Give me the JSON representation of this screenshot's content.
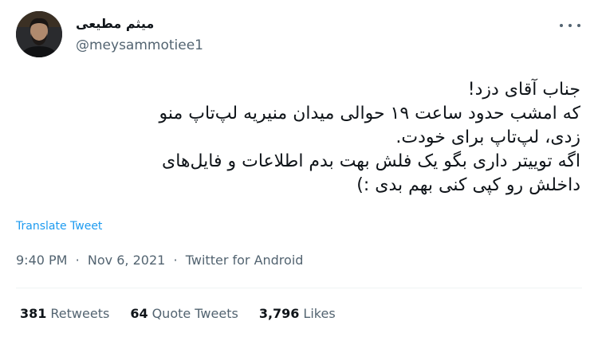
{
  "author": {
    "display_name": "میثم مطیعی",
    "handle": "@meysammotiee1"
  },
  "tweet": {
    "lines": [
      "جناب آقای دزد!",
      "که امشب حدود ساعت ۱۹ حوالی میدان منیریه لپ‌تاپ منو",
      "زدی، لپ‌تاپ برای خودت.",
      "اگه توییتر داری بگو یک فلش بهت بدم اطلاعات و فایل‌های",
      "داخلش رو کپی کنی بهم بدی :)"
    ],
    "translate_label": "Translate Tweet",
    "time": "9:40 PM",
    "date": "Nov 6, 2021",
    "source": "Twitter for Android",
    "separator": "·"
  },
  "stats": {
    "retweets_count": "381",
    "retweets_label": "Retweets",
    "quotes_count": "64",
    "quotes_label": "Quote Tweets",
    "likes_count": "3,796",
    "likes_label": "Likes"
  },
  "icons": {
    "more": "more-horizontal-icon"
  },
  "colors": {
    "link": "#1d9bf0",
    "text": "#0f1419",
    "secondary": "#536471",
    "divider": "#eff3f4"
  }
}
